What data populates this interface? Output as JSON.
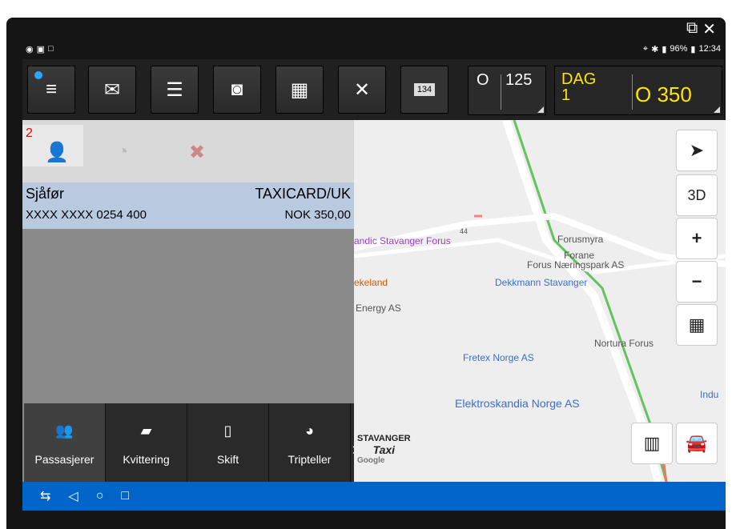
{
  "status": {
    "left_icons": [
      "eye-icon",
      "screen-icon",
      "square-icon"
    ],
    "right_text": "96%",
    "time": "12:34"
  },
  "toolbar": {
    "buttons": [
      "menu-icon",
      "mail-icon",
      "list-icon",
      "meter-icon",
      "grid-icon",
      "tools-icon",
      "taximeter-icon"
    ],
    "counter1": {
      "label": "O",
      "value": "125"
    },
    "counter2": {
      "day_label": "DAG",
      "day_value": "1",
      "label": "O",
      "value": "350"
    }
  },
  "left": {
    "tab_badge": "2",
    "driver_label": "Sjåfør",
    "card_type": "TAXICARD/UK",
    "card_number": "XXXX XXXX 0254 400",
    "amount": "NOK 350,00"
  },
  "bottom_tabs": [
    "Passasjerer",
    "Kvittering",
    "Skift",
    "Tripteller"
  ],
  "map": {
    "labels": [
      "andic Stavanger Forus",
      "Forusmyra",
      "Forane",
      "Forus Næringspark AS",
      "ekeland",
      "Dekkmann Stavanger",
      "Energy AS",
      "Nortura Forus",
      "Fretex Norge AS",
      "Elektroskandia Norge AS",
      "Indu",
      "44"
    ],
    "buttons": [
      "3D",
      "+",
      "−"
    ],
    "logo_line1": "STAVANGER",
    "logo_line2": "Taxi",
    "google": "Google"
  }
}
